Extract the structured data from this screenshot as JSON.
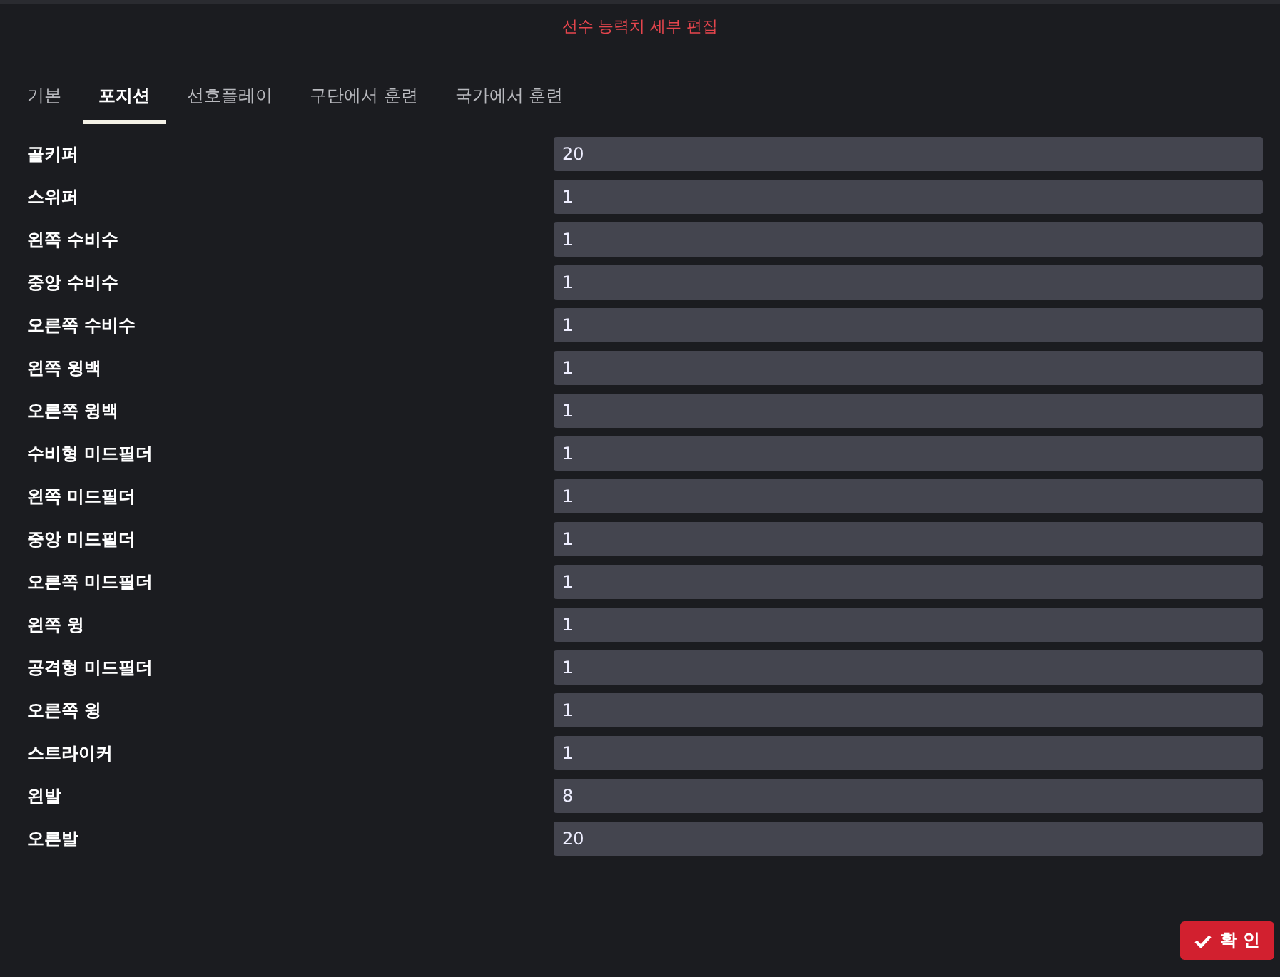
{
  "window": {
    "title": "선수 능력치 세부 편집"
  },
  "tabs": [
    {
      "label": "기본",
      "selected": false
    },
    {
      "label": "포지션",
      "selected": true
    },
    {
      "label": "선호플레이",
      "selected": false
    },
    {
      "label": "구단에서 훈련",
      "selected": false
    },
    {
      "label": "국가에서 훈련",
      "selected": false
    }
  ],
  "fields": [
    {
      "label": "골키퍼",
      "value": "20"
    },
    {
      "label": "스위퍼",
      "value": "1"
    },
    {
      "label": "왼쪽 수비수",
      "value": "1"
    },
    {
      "label": "중앙 수비수",
      "value": "1"
    },
    {
      "label": "오른쪽 수비수",
      "value": "1"
    },
    {
      "label": "왼쪽 윙백",
      "value": "1"
    },
    {
      "label": "오른쪽 윙백",
      "value": "1"
    },
    {
      "label": "수비형 미드필더",
      "value": "1"
    },
    {
      "label": "왼쪽 미드필더",
      "value": "1"
    },
    {
      "label": "중앙 미드필더",
      "value": "1"
    },
    {
      "label": "오른쪽 미드필더",
      "value": "1"
    },
    {
      "label": "왼쪽 윙",
      "value": "1"
    },
    {
      "label": "공격형 미드필더",
      "value": "1"
    },
    {
      "label": "오른쪽 윙",
      "value": "1"
    },
    {
      "label": "스트라이커",
      "value": "1"
    },
    {
      "label": "왼발",
      "value": "8"
    },
    {
      "label": "오른발",
      "value": "20"
    }
  ],
  "confirm_button": {
    "label": "확 인"
  }
}
